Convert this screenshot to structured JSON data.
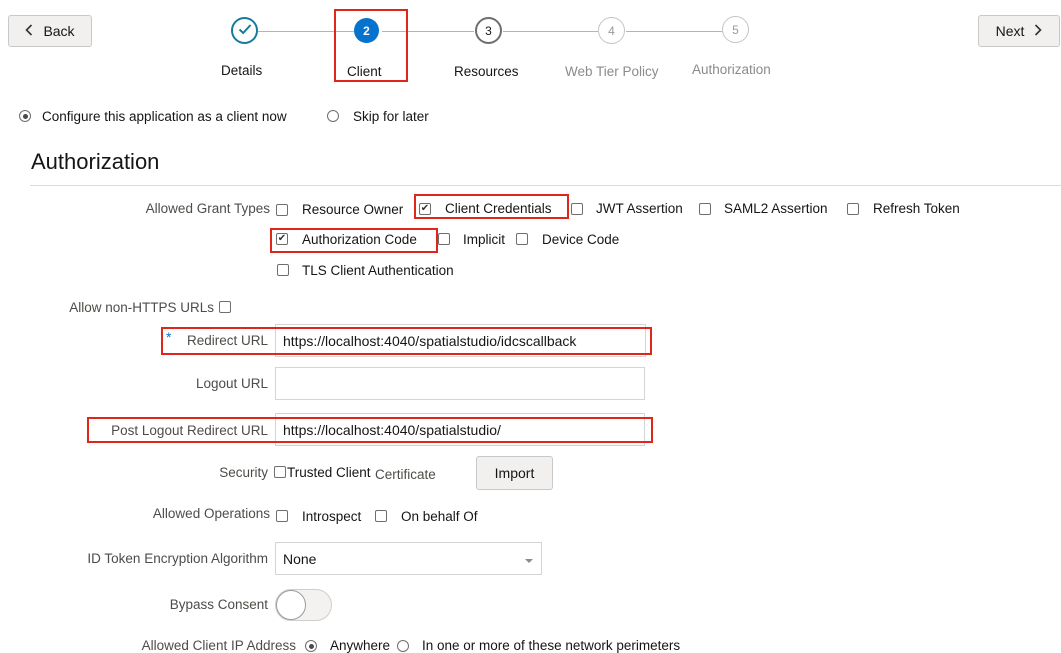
{
  "nav": {
    "back_label": "Back",
    "next_label": "Next"
  },
  "steps": [
    {
      "number": "",
      "label": "Details",
      "state": "done"
    },
    {
      "number": "2",
      "label": "Client",
      "state": "active"
    },
    {
      "number": "3",
      "label": "Resources",
      "state": "upcoming"
    },
    {
      "number": "4",
      "label": "Web Tier Policy",
      "state": "disabled"
    },
    {
      "number": "5",
      "label": "Authorization",
      "state": "disabled"
    }
  ],
  "config_choice": {
    "configure_label": "Configure this application as a client now",
    "skip_label": "Skip for later",
    "selected": "configure"
  },
  "section_title": "Authorization",
  "grant_types": {
    "label": "Allowed Grant Types",
    "options": [
      {
        "label": "Resource Owner",
        "checked": false
      },
      {
        "label": "Client Credentials",
        "checked": true
      },
      {
        "label": "JWT Assertion",
        "checked": false
      },
      {
        "label": "SAML2 Assertion",
        "checked": false
      },
      {
        "label": "Refresh Token",
        "checked": false
      },
      {
        "label": "Authorization Code",
        "checked": true
      },
      {
        "label": "Implicit",
        "checked": false
      },
      {
        "label": "Device Code",
        "checked": false
      },
      {
        "label": "TLS Client Authentication",
        "checked": false
      }
    ]
  },
  "non_https": {
    "label": "Allow non-HTTPS URLs",
    "checked": false
  },
  "redirect_url": {
    "required_mark": "*",
    "label": "Redirect URL",
    "value": "https://localhost:4040/spatialstudio/idcscallback"
  },
  "logout_url": {
    "label": "Logout URL",
    "value": ""
  },
  "post_logout_redirect_url": {
    "label": "Post Logout Redirect URL",
    "value": "https://localhost:4040/spatialstudio/"
  },
  "security": {
    "label": "Security",
    "trusted_client_label": "Trusted Client",
    "certificate_label": "Certificate",
    "import_label": "Import",
    "trusted_checked": false
  },
  "allowed_operations": {
    "label": "Allowed Operations",
    "options": [
      {
        "label": "Introspect",
        "checked": false
      },
      {
        "label": "On behalf Of",
        "checked": false
      }
    ]
  },
  "id_token_encryption": {
    "label": "ID Token Encryption Algorithm",
    "value": "None"
  },
  "bypass_consent": {
    "label": "Bypass Consent",
    "on": false
  },
  "allowed_client_ip": {
    "label": "Allowed Client IP Address",
    "anywhere_label": "Anywhere",
    "perimeter_label": "In one or more of these network perimeters",
    "selected": "anywhere"
  },
  "colors": {
    "accent": "#0572ce",
    "highlight_red": "#e0261a",
    "done_teal": "#157b9d"
  }
}
